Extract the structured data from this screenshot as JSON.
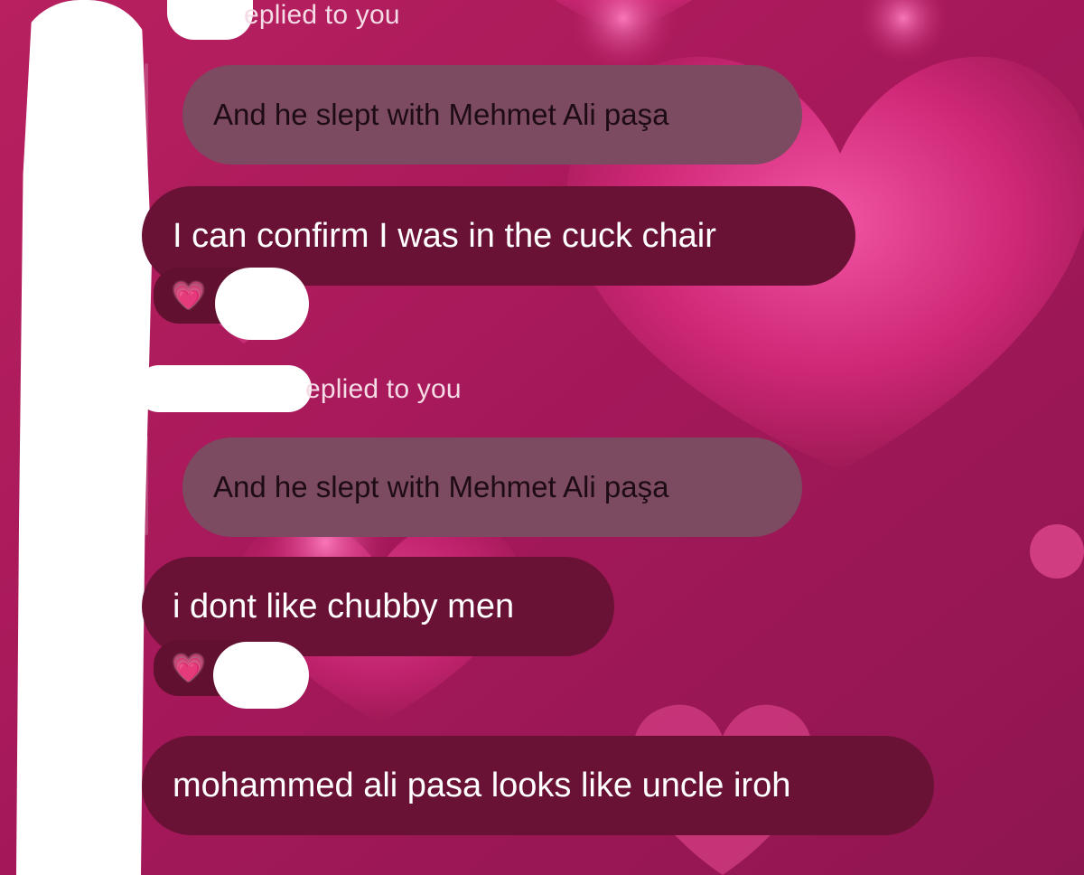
{
  "colors": {
    "background": "#a01a55",
    "quote_bubble": "#7c4a61",
    "message_bubble": "#6a1236",
    "reply_header_text": "#f5dbe6",
    "heart_emoji": "#ff9ad0"
  },
  "messages": [
    {
      "reply_header": "eplied to you",
      "quoted_text": "And he slept with Mehmet Ali paşa",
      "text": "I can confirm I was in the cuck chair",
      "reaction": {
        "emoji": "💗",
        "icon": "pink-heart-icon"
      }
    },
    {
      "reply_header": "eplied to you",
      "quoted_text": "And he slept with Mehmet Ali paşa",
      "text": "i dont like chubby men",
      "reaction": {
        "emoji": "💗",
        "icon": "pink-heart-icon"
      }
    },
    {
      "text": "mohammed ali pasa looks like uncle iroh"
    }
  ]
}
